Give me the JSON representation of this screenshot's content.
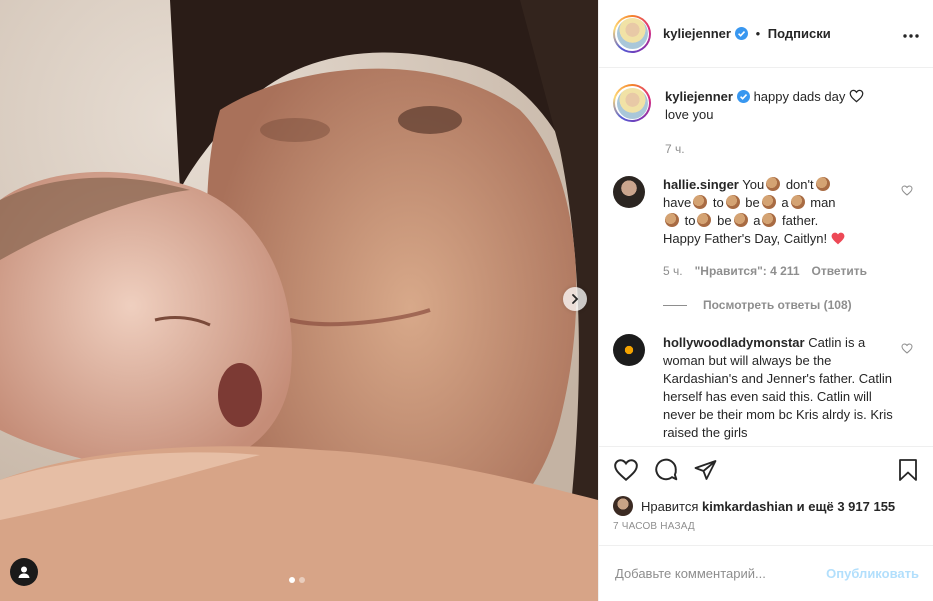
{
  "post": {
    "author": "kyliejenner",
    "verified": true,
    "separator": "•",
    "follow_label": "Подписки",
    "caption_text": "happy dads day",
    "caption_line2": "love you",
    "caption_time": "7 ч.",
    "slides_total": 2,
    "slide_active": 1
  },
  "comments": [
    {
      "user": "hallie.singer",
      "parts": [
        "You",
        "don't",
        "have",
        "to",
        "be",
        "a",
        "man",
        "to",
        "be",
        "a",
        "father."
      ],
      "tail": "Happy Father's Day, Caitlyn!",
      "time": "5 ч.",
      "likes_label": "\"Нравится\": 4 211",
      "reply_label": "Ответить",
      "view_replies": "Посмотреть ответы (108)"
    },
    {
      "user": "hollywoodladymonstar",
      "text": "Catlin is a woman but will always be the Kardashian's and Jenner's father. Catlin herself has even said this. Catlin will never be their mom bc Kris alrdy is. Kris raised the girls"
    }
  ],
  "liked_by": {
    "prefix": "Нравится",
    "user": "kimkardashian",
    "suffix": "и ещё 3 917 155"
  },
  "posted_ago": "7 часов назад",
  "add_comment": {
    "placeholder": "Добавьте комментарий...",
    "publish_label": "Опубликовать"
  },
  "colors": {
    "verified": "#3897f0",
    "heart_red": "#ed4956",
    "publish_disabled": "#b2dffc",
    "muted": "#8e8e8e"
  },
  "icons": [
    "chevron-right-icon",
    "user-tag-icon",
    "more-icon",
    "heart-icon",
    "comment-icon",
    "share-icon",
    "bookmark-icon",
    "verified-icon"
  ]
}
